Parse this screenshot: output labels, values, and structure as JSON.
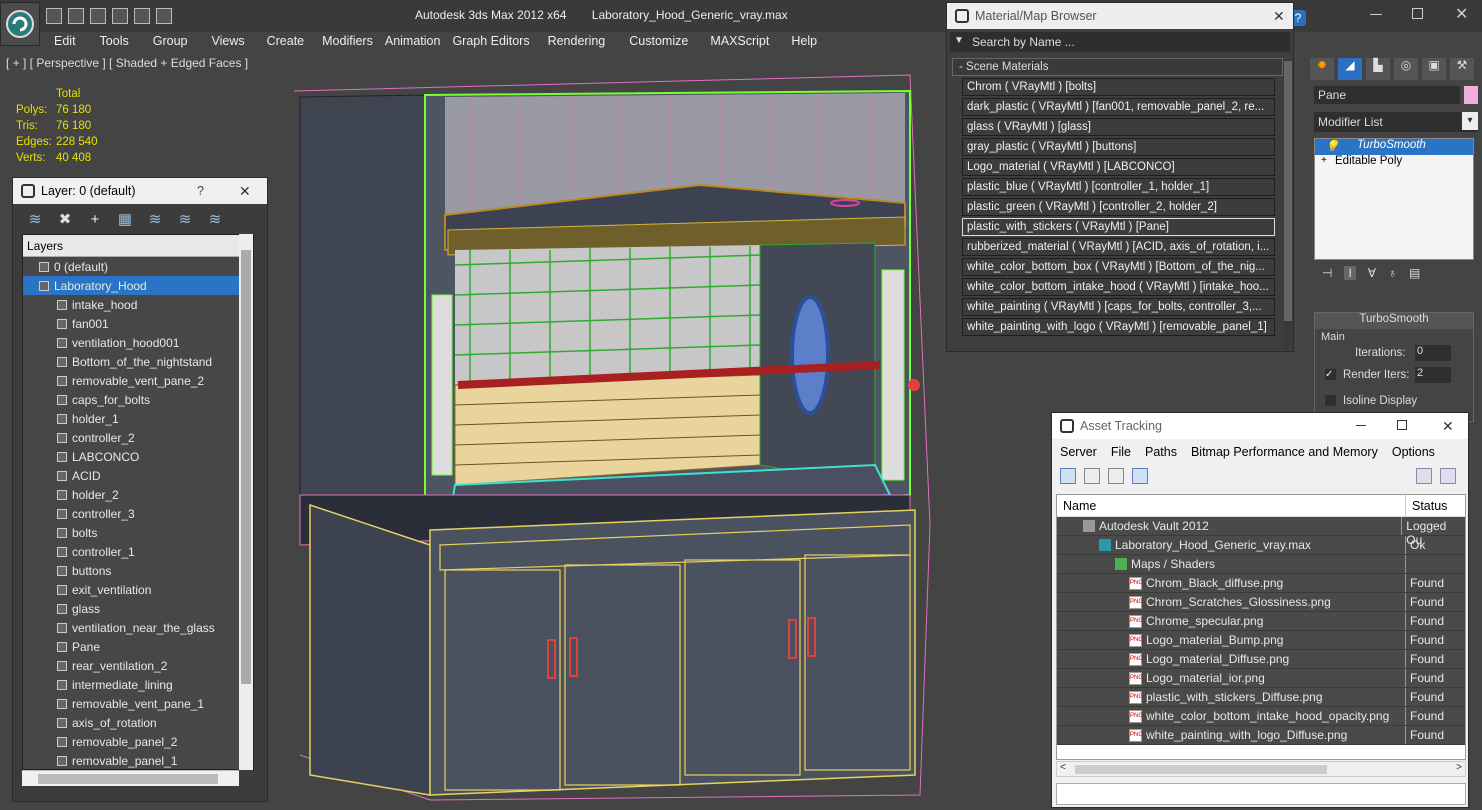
{
  "title": {
    "app": "Autodesk 3ds Max  2012 x64",
    "file": "Laboratory_Hood_Generic_vray.max"
  },
  "menu": [
    "Edit",
    "Tools",
    "Group",
    "Views",
    "Create",
    "Modifiers",
    "Animation",
    "Graph Editors",
    "Rendering",
    "Customize",
    "MAXScript",
    "Help"
  ],
  "viewport": {
    "label": "[ + ] [ Perspective ] [ Shaded + Edged Faces ]"
  },
  "stats": {
    "total_label": "Total",
    "rows": [
      {
        "k": "Polys:",
        "v": "76 180"
      },
      {
        "k": "Tris:",
        "v": "76 180"
      },
      {
        "k": "Edges:",
        "v": "228 540"
      },
      {
        "k": "Verts:",
        "v": "40 408"
      }
    ]
  },
  "layer_panel": {
    "title": "Layer: 0 (default)",
    "help": "?",
    "header": "Layers",
    "rows": [
      {
        "label": "0 (default)",
        "level": 0,
        "check": "✓"
      },
      {
        "label": "Laboratory_Hood",
        "level": 0,
        "selected": true
      },
      {
        "label": "intake_hood",
        "level": 1
      },
      {
        "label": "fan001",
        "level": 1
      },
      {
        "label": "ventilation_hood001",
        "level": 1
      },
      {
        "label": "Bottom_of_the_nightstand",
        "level": 1
      },
      {
        "label": "removable_vent_pane_2",
        "level": 1
      },
      {
        "label": "caps_for_bolts",
        "level": 1
      },
      {
        "label": "holder_1",
        "level": 1
      },
      {
        "label": "controller_2",
        "level": 1
      },
      {
        "label": "LABCONCO",
        "level": 1
      },
      {
        "label": "ACID",
        "level": 1
      },
      {
        "label": "holder_2",
        "level": 1
      },
      {
        "label": "controller_3",
        "level": 1
      },
      {
        "label": "bolts",
        "level": 1
      },
      {
        "label": "controller_1",
        "level": 1
      },
      {
        "label": "buttons",
        "level": 1
      },
      {
        "label": "exit_ventilation",
        "level": 1
      },
      {
        "label": "glass",
        "level": 1
      },
      {
        "label": "ventilation_near_the_glass",
        "level": 1
      },
      {
        "label": "Pane",
        "level": 1
      },
      {
        "label": "rear_ventilation_2",
        "level": 1
      },
      {
        "label": "intermediate_lining",
        "level": 1
      },
      {
        "label": "removable_vent_pane_1",
        "level": 1
      },
      {
        "label": "axis_of_rotation",
        "level": 1
      },
      {
        "label": "removable_panel_2",
        "level": 1
      },
      {
        "label": "removable_panel_1",
        "level": 1
      }
    ]
  },
  "material_browser": {
    "title": "Material/Map Browser",
    "search_placeholder": "Search by Name ...",
    "section": "- Scene Materials",
    "items": [
      "Chrom  ( VRayMtl )  [bolts]",
      "dark_plastic  ( VRayMtl )  [fan001, removable_panel_2, re...",
      "glass  ( VRayMtl )  [glass]",
      "gray_plastic  ( VRayMtl )  [buttons]",
      "Logo_material  ( VRayMtl )  [LABCONCO]",
      "plastic_blue  ( VRayMtl )  [controller_1, holder_1]",
      "plastic_green  ( VRayMtl )  [controller_2, holder_2]",
      "plastic_with_stickers  ( VRayMtl )  [Pane]",
      "rubberized_material  ( VRayMtl )  [ACID, axis_of_rotation, i...",
      "white_color_bottom_box  ( VRayMtl )  [Bottom_of_the_nig...",
      "white_color_bottom_intake_hood  ( VRayMtl )  [intake_hoo...",
      "white_painting  ( VRayMtl )  [caps_for_bolts, controller_3,...",
      "white_painting_with_logo  ( VRayMtl )  [removable_panel_1]"
    ],
    "selected_index": 7
  },
  "command_panel": {
    "object_name": "Pane",
    "modifier_list": "Modifier List",
    "stack": [
      "TurboSmooth",
      "Editable Poly"
    ],
    "rollout": "TurboSmooth",
    "group": "Main",
    "iterations_label": "Iterations:",
    "iterations": "0",
    "render_iters_label": "Render Iters:",
    "render_iters": "2",
    "isoline": "Isoline Display"
  },
  "asset_tracking": {
    "title": "Asset Tracking",
    "menu": [
      "Server",
      "File",
      "Paths",
      "Bitmap Performance and Memory",
      "Options"
    ],
    "columns": [
      "Name",
      "Status"
    ],
    "rows": [
      {
        "name": "Autodesk Vault 2012",
        "status": "Logged Ou",
        "level": 1,
        "icon": "vault"
      },
      {
        "name": "Laboratory_Hood_Generic_vray.max",
        "status": "Ok",
        "level": 2,
        "icon": "max"
      },
      {
        "name": "Maps / Shaders",
        "status": "",
        "level": 3,
        "icon": "maps"
      },
      {
        "name": "Chrom_Black_diffuse.png",
        "status": "Found",
        "level": 4,
        "icon": "png"
      },
      {
        "name": "Chrom_Scratches_Glossiness.png",
        "status": "Found",
        "level": 4,
        "icon": "png"
      },
      {
        "name": "Chrome_specular.png",
        "status": "Found",
        "level": 4,
        "icon": "png"
      },
      {
        "name": "Logo_material_Bump.png",
        "status": "Found",
        "level": 4,
        "icon": "png"
      },
      {
        "name": "Logo_material_Diffuse.png",
        "status": "Found",
        "level": 4,
        "icon": "png"
      },
      {
        "name": "Logo_material_ior.png",
        "status": "Found",
        "level": 4,
        "icon": "png"
      },
      {
        "name": "plastic_with_stickers_Diffuse.png",
        "status": "Found",
        "level": 4,
        "icon": "png"
      },
      {
        "name": "white_color_bottom_intake_hood_opacity.png",
        "status": "Found",
        "level": 4,
        "icon": "png"
      },
      {
        "name": "white_painting_with_logo_Diffuse.png",
        "status": "Found",
        "level": 4,
        "icon": "png"
      }
    ]
  }
}
